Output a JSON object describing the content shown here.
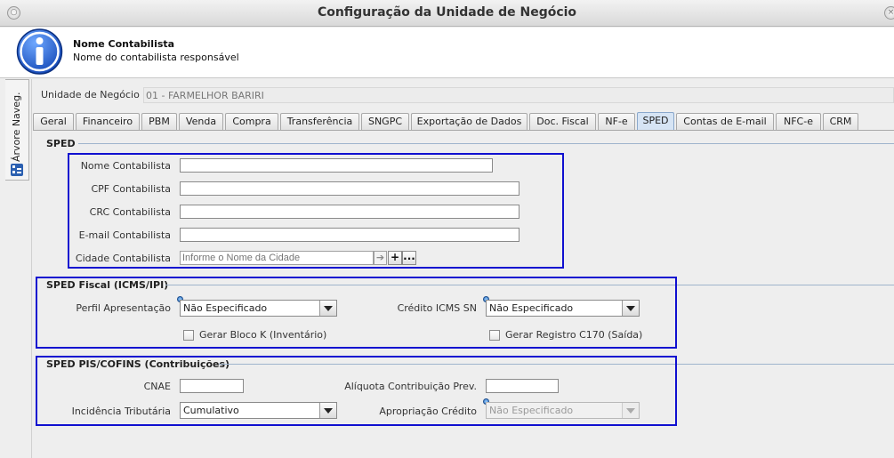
{
  "window": {
    "title": "Configuração da Unidade de Negócio"
  },
  "header": {
    "title": "Nome Contabilista",
    "subtitle": "Nome do contabilista responsável",
    "icon": "info-icon"
  },
  "side_tab": {
    "label": "Árvore Naveg.",
    "icon": "tree-icon"
  },
  "unidade": {
    "label": "Unidade de Negócio",
    "value": "01 - FARMELHOR BARIRI"
  },
  "tabs": [
    {
      "label": "Geral"
    },
    {
      "label": "Financeiro"
    },
    {
      "label": "PBM"
    },
    {
      "label": "Venda"
    },
    {
      "label": "Compra"
    },
    {
      "label": "Transferência"
    },
    {
      "label": "SNGPC"
    },
    {
      "label": "Exportação de Dados"
    },
    {
      "label": "Doc. Fiscal"
    },
    {
      "label": "NF-e"
    },
    {
      "label": "SPED"
    },
    {
      "label": "Contas de E-mail"
    },
    {
      "label": "NFC-e"
    },
    {
      "label": "CRM"
    }
  ],
  "active_tab": "SPED",
  "sped": {
    "title": "SPED",
    "nome_label": "Nome Contabilista",
    "nome_value": "",
    "cpf_label": "CPF Contabilista",
    "cpf_value": "",
    "crc_label": "CRC Contabilista",
    "crc_value": "",
    "email_label": "E-mail Contabilista",
    "email_value": "",
    "cidade_label": "Cidade Contabilista",
    "cidade_placeholder": "Informe o Nome da Cidade",
    "add_label": "+",
    "more_label": "..."
  },
  "sped_fiscal": {
    "title": "SPED Fiscal (ICMS/IPI)",
    "perfil_label": "Perfil Apresentação",
    "perfil_value": "Não Especificado",
    "credito_label": "Crédito ICMS SN",
    "credito_value": "Não Especificado",
    "bloco_k_label": "Gerar Bloco K (Inventário)",
    "bloco_k_checked": false,
    "c170_label": "Gerar Registro C170 (Saída)",
    "c170_checked": false
  },
  "sped_pis": {
    "title": "SPED PIS/COFINS (Contribuições)",
    "cnae_label": "CNAE",
    "cnae_value": "",
    "aliquota_label": "Alíquota Contribuição Prev.",
    "aliquota_value": "",
    "incidencia_label": "Incidência Tributária",
    "incidencia_value": "Cumulativo",
    "apropriacao_label": "Apropriação Crédito",
    "apropriacao_value": "Não Especificado"
  },
  "colors": {
    "highlight": "#1010d0",
    "info_blue": "#1f5fd1",
    "active_tab": "#d6e4f4"
  }
}
